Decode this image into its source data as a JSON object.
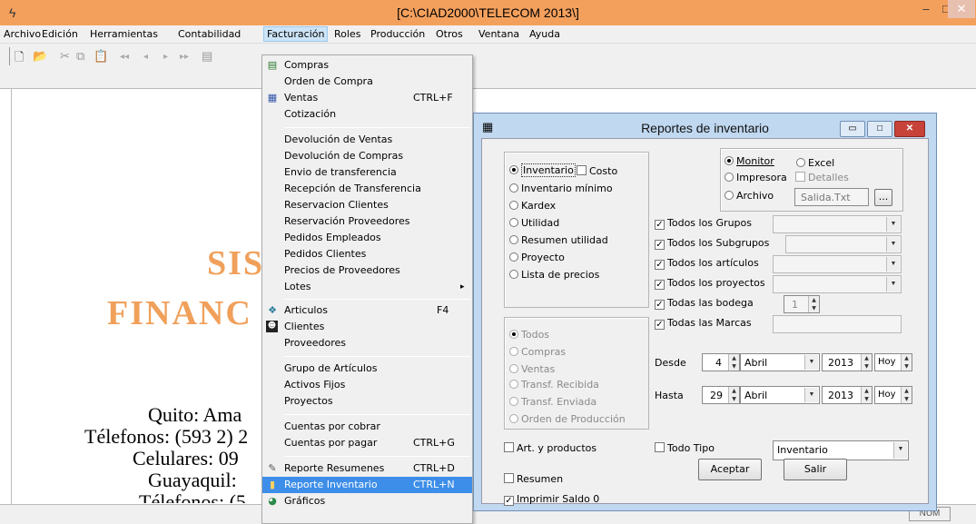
{
  "window": {
    "title": "[C:\\CIAD2000\\TELECOM 2013\\]",
    "app_icon": "ϟ",
    "minimize": "–",
    "maximize": "□",
    "close": "✕"
  },
  "menubar": [
    "Archivo",
    "Edición",
    "Herramientas",
    "Contabilidad",
    "Facturación",
    "Roles",
    "Producción",
    "Otros",
    "Ventana",
    "Ayuda"
  ],
  "toolbar": {
    "icons": [
      "new-icon",
      "open-icon",
      "cut-icon",
      "copy-icon",
      "paste-icon",
      "first-icon",
      "prev-icon",
      "next-icon",
      "last-icon",
      "preview-icon"
    ]
  },
  "background": {
    "line1": "SIS",
    "line2": "FINANC",
    "address1": "Quito: Ama",
    "address2": "Télefonos: (593 2) 2",
    "address3": "Celulares: 09",
    "address4": "Guayaquil:",
    "address5": "Télefonos: (5"
  },
  "status": {
    "num": "NUM"
  },
  "facturacion_menu": {
    "items": [
      {
        "label": "Compras",
        "shortcut": ""
      },
      {
        "label": "Orden de Compra",
        "shortcut": ""
      },
      {
        "label": "Ventas",
        "shortcut": "CTRL+F"
      },
      {
        "label": "Cotización",
        "shortcut": ""
      },
      {
        "label": "Devolución de Ventas",
        "shortcut": ""
      },
      {
        "label": "Devolución de Compras",
        "shortcut": ""
      },
      {
        "label": "Envio de transferencia",
        "shortcut": ""
      },
      {
        "label": "Recepción de Transferencia",
        "shortcut": ""
      },
      {
        "label": "Reservacion Clientes",
        "shortcut": ""
      },
      {
        "label": "Reservación Proveedores",
        "shortcut": ""
      },
      {
        "label": "Pedidos Empleados",
        "shortcut": ""
      },
      {
        "label": "Pedidos Clientes",
        "shortcut": ""
      },
      {
        "label": "Precios de Proveedores",
        "shortcut": ""
      },
      {
        "label": "Lotes",
        "shortcut": "▸"
      },
      {
        "label": "Articulos",
        "shortcut": "F4"
      },
      {
        "label": "Clientes",
        "shortcut": ""
      },
      {
        "label": "Proveedores",
        "shortcut": ""
      },
      {
        "label": "Grupo de Artículos",
        "shortcut": ""
      },
      {
        "label": "Activos Fijos",
        "shortcut": ""
      },
      {
        "label": "Proyectos",
        "shortcut": ""
      },
      {
        "label": "Cuentas por cobrar",
        "shortcut": ""
      },
      {
        "label": "Cuentas por pagar",
        "shortcut": "CTRL+G"
      },
      {
        "label": "Reporte Resumenes",
        "shortcut": "CTRL+D"
      },
      {
        "label": "Reporte Inventario",
        "shortcut": "CTRL+N"
      },
      {
        "label": "Gráficos",
        "shortcut": ""
      }
    ]
  },
  "dialog": {
    "title": "Reportes de inventario",
    "report_types": [
      "Inventario",
      "Inventario mínimo",
      "Kardex",
      "Utilidad",
      "Resumen utilidad",
      "Proyecto",
      "Lista de precios"
    ],
    "costo_label": "Costo",
    "movement_types": [
      "Todos",
      "Compras",
      "Ventas",
      "Transf. Recibida",
      "Transf. Enviada",
      "Orden de Producción"
    ],
    "output": {
      "monitor": "Monitor",
      "excel": "Excel",
      "impresora": "Impresora",
      "detalles": "Detalles",
      "archivo": "Archivo",
      "file_value": "Salida.Txt",
      "browse": "..."
    },
    "filters": {
      "grupos": "Todos los Grupos",
      "subgrupos": "Todos los Subgrupos",
      "articulos": "Todos los artículos",
      "proyectos": "Todos los proyectos",
      "bodega": "Todas las bodega",
      "bodega_value": "1",
      "marcas": "Todas las Marcas"
    },
    "desde": {
      "label": "Desde",
      "day": "4",
      "month": "Abril",
      "year": "2013",
      "hoy": "Hoy"
    },
    "hasta": {
      "label": "Hasta",
      "day": "29",
      "month": "Abril",
      "year": "2013",
      "hoy": "Hoy"
    },
    "art_productos": "Art. y productos",
    "resumen": "Resumen",
    "imprimir_saldo": "Imprimir Saldo 0",
    "todo_tipo": "Todo Tipo",
    "tipo_value": "Inventario",
    "aceptar": "Aceptar",
    "salir": "Salir"
  }
}
